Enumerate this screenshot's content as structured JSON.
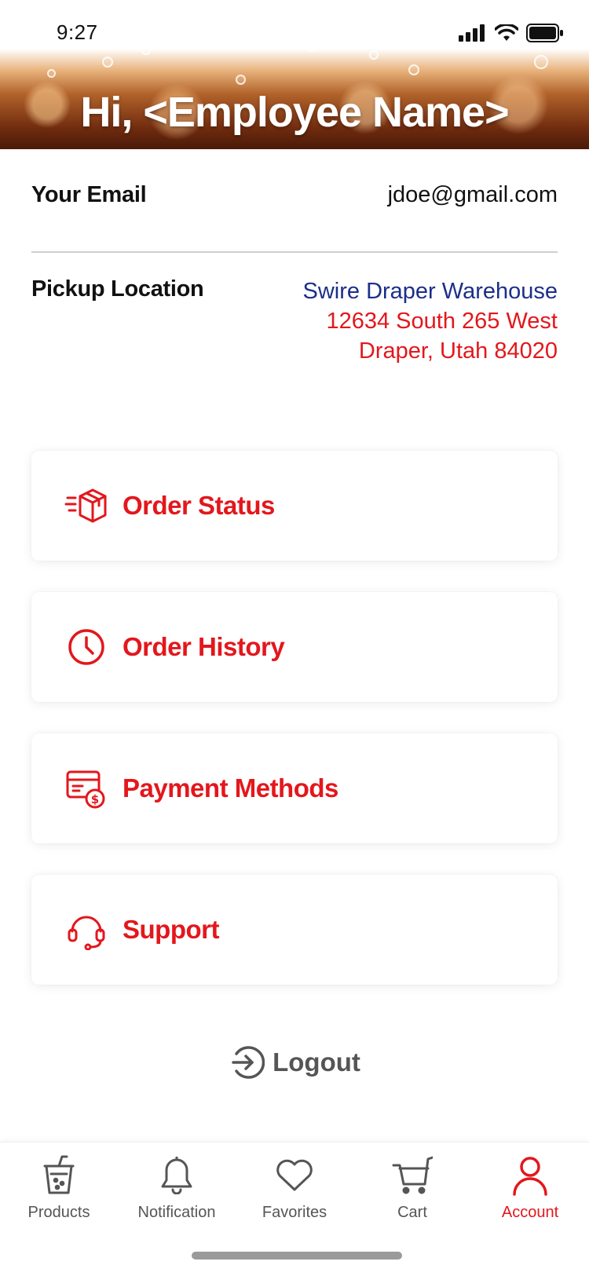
{
  "status_bar": {
    "time": "9:27"
  },
  "header": {
    "greeting": "Hi, <Employee Name>"
  },
  "account": {
    "email_label": "Your Email",
    "email_value": "jdoe@gmail.com",
    "pickup_label": "Pickup Location",
    "pickup_name": "Swire Draper Warehouse",
    "pickup_street": "12634 South 265 West",
    "pickup_city": "Draper, Utah 84020"
  },
  "menu": [
    {
      "label": "Order Status",
      "icon": "package-icon"
    },
    {
      "label": "Order History",
      "icon": "clock-icon"
    },
    {
      "label": "Payment Methods",
      "icon": "billing-icon"
    },
    {
      "label": "Support",
      "icon": "headset-icon"
    }
  ],
  "logout": {
    "label": "Logout",
    "icon": "logout-icon"
  },
  "tabs": [
    {
      "label": "Products",
      "icon": "drink-cup-icon",
      "active": false
    },
    {
      "label": "Notification",
      "icon": "bell-icon",
      "active": false
    },
    {
      "label": "Favorites",
      "icon": "heart-icon",
      "active": false
    },
    {
      "label": "Cart",
      "icon": "cart-icon",
      "active": false
    },
    {
      "label": "Account",
      "icon": "user-icon",
      "active": true
    }
  ],
  "colors": {
    "accent": "#e3171c",
    "link_blue": "#1b2f8a",
    "muted": "#555555"
  }
}
